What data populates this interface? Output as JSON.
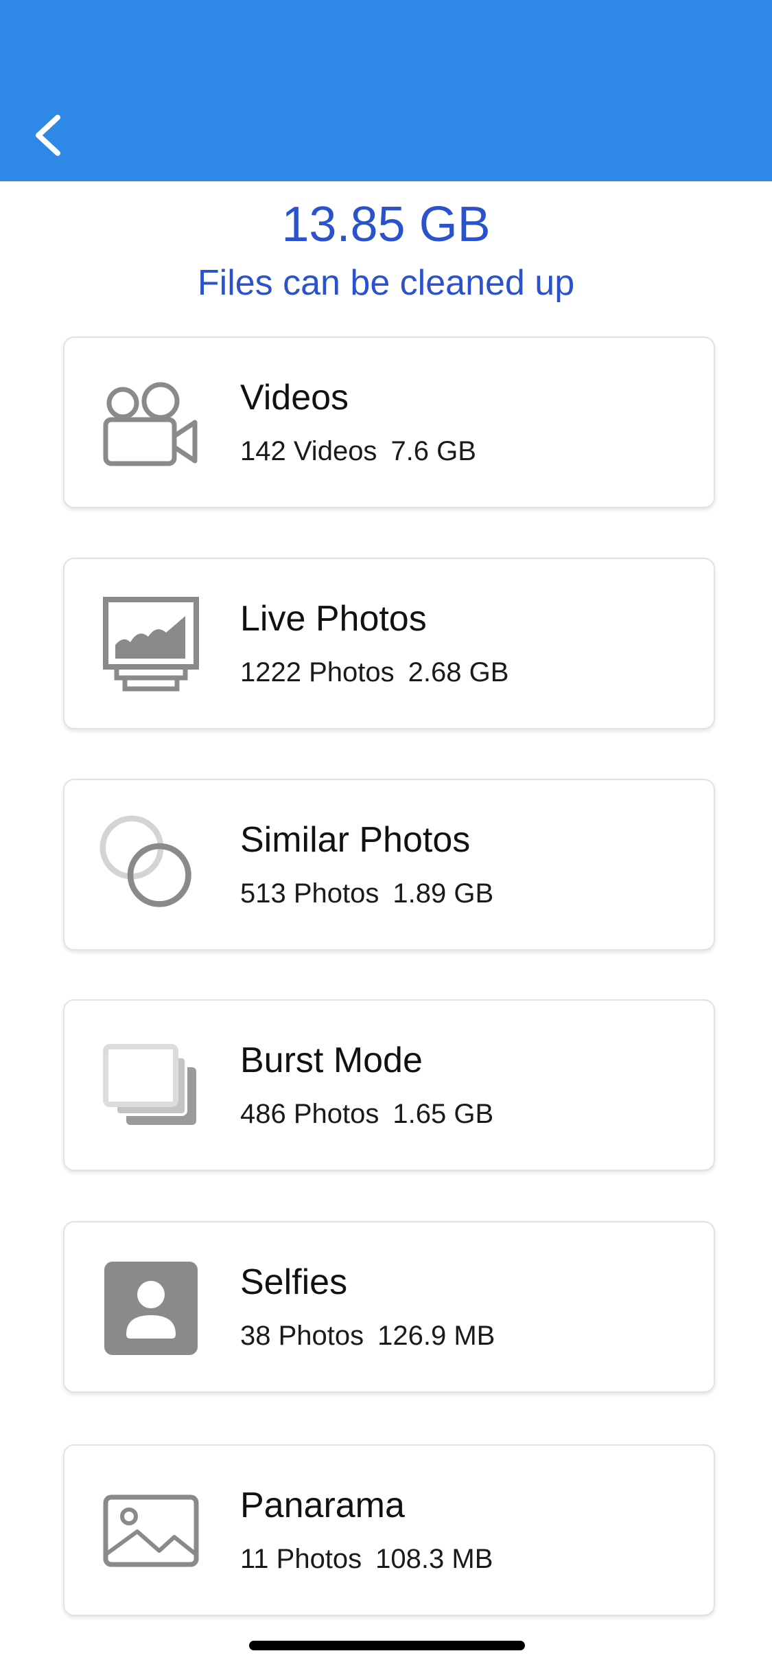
{
  "colors": {
    "header": "#2d89e5",
    "accent_text": "#2a52cc",
    "icon_gray": "#8a8a8a"
  },
  "summary": {
    "size": "13.85 GB",
    "caption": "Files can be cleaned up"
  },
  "categories": [
    {
      "title": "Videos",
      "count": "142 Videos",
      "size": "7.6 GB",
      "icon": "video-camera-icon"
    },
    {
      "title": "Live Photos",
      "count": "1222 Photos",
      "size": "2.68 GB",
      "icon": "live-photo-icon"
    },
    {
      "title": "Similar Photos",
      "count": "513 Photos",
      "size": "1.89 GB",
      "icon": "overlapping-circles-icon"
    },
    {
      "title": "Burst Mode",
      "count": "486 Photos",
      "size": "1.65 GB",
      "icon": "stacked-frames-icon"
    },
    {
      "title": "Selfies",
      "count": "38 Photos",
      "size": "126.9 MB",
      "icon": "person-portrait-icon"
    },
    {
      "title": "Panarama",
      "count": "11 Photos",
      "size": "108.3 MB",
      "icon": "landscape-image-icon"
    }
  ]
}
